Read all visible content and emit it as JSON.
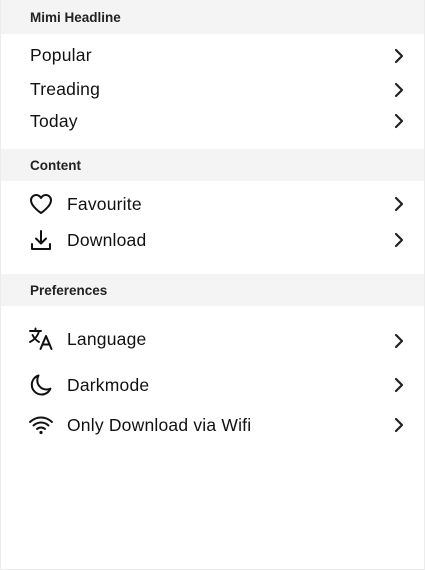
{
  "sections": {
    "headline": {
      "title": "Mimi Headline",
      "items": [
        {
          "label": "Popular"
        },
        {
          "label": "Treading"
        },
        {
          "label": "Today"
        }
      ]
    },
    "content": {
      "title": "Content",
      "items": [
        {
          "label": "Favourite",
          "icon": "heart-icon"
        },
        {
          "label": "Download",
          "icon": "download-icon"
        }
      ]
    },
    "preferences": {
      "title": "Preferences",
      "items": [
        {
          "label": "Language",
          "icon": "translate-icon"
        },
        {
          "label": "Darkmode",
          "icon": "moon-icon"
        },
        {
          "label": "Only Download via Wifi",
          "icon": "wifi-icon"
        }
      ]
    }
  },
  "colors": {
    "section_background": "#f4f4f4",
    "text": "#111111",
    "icon": "#111111"
  }
}
